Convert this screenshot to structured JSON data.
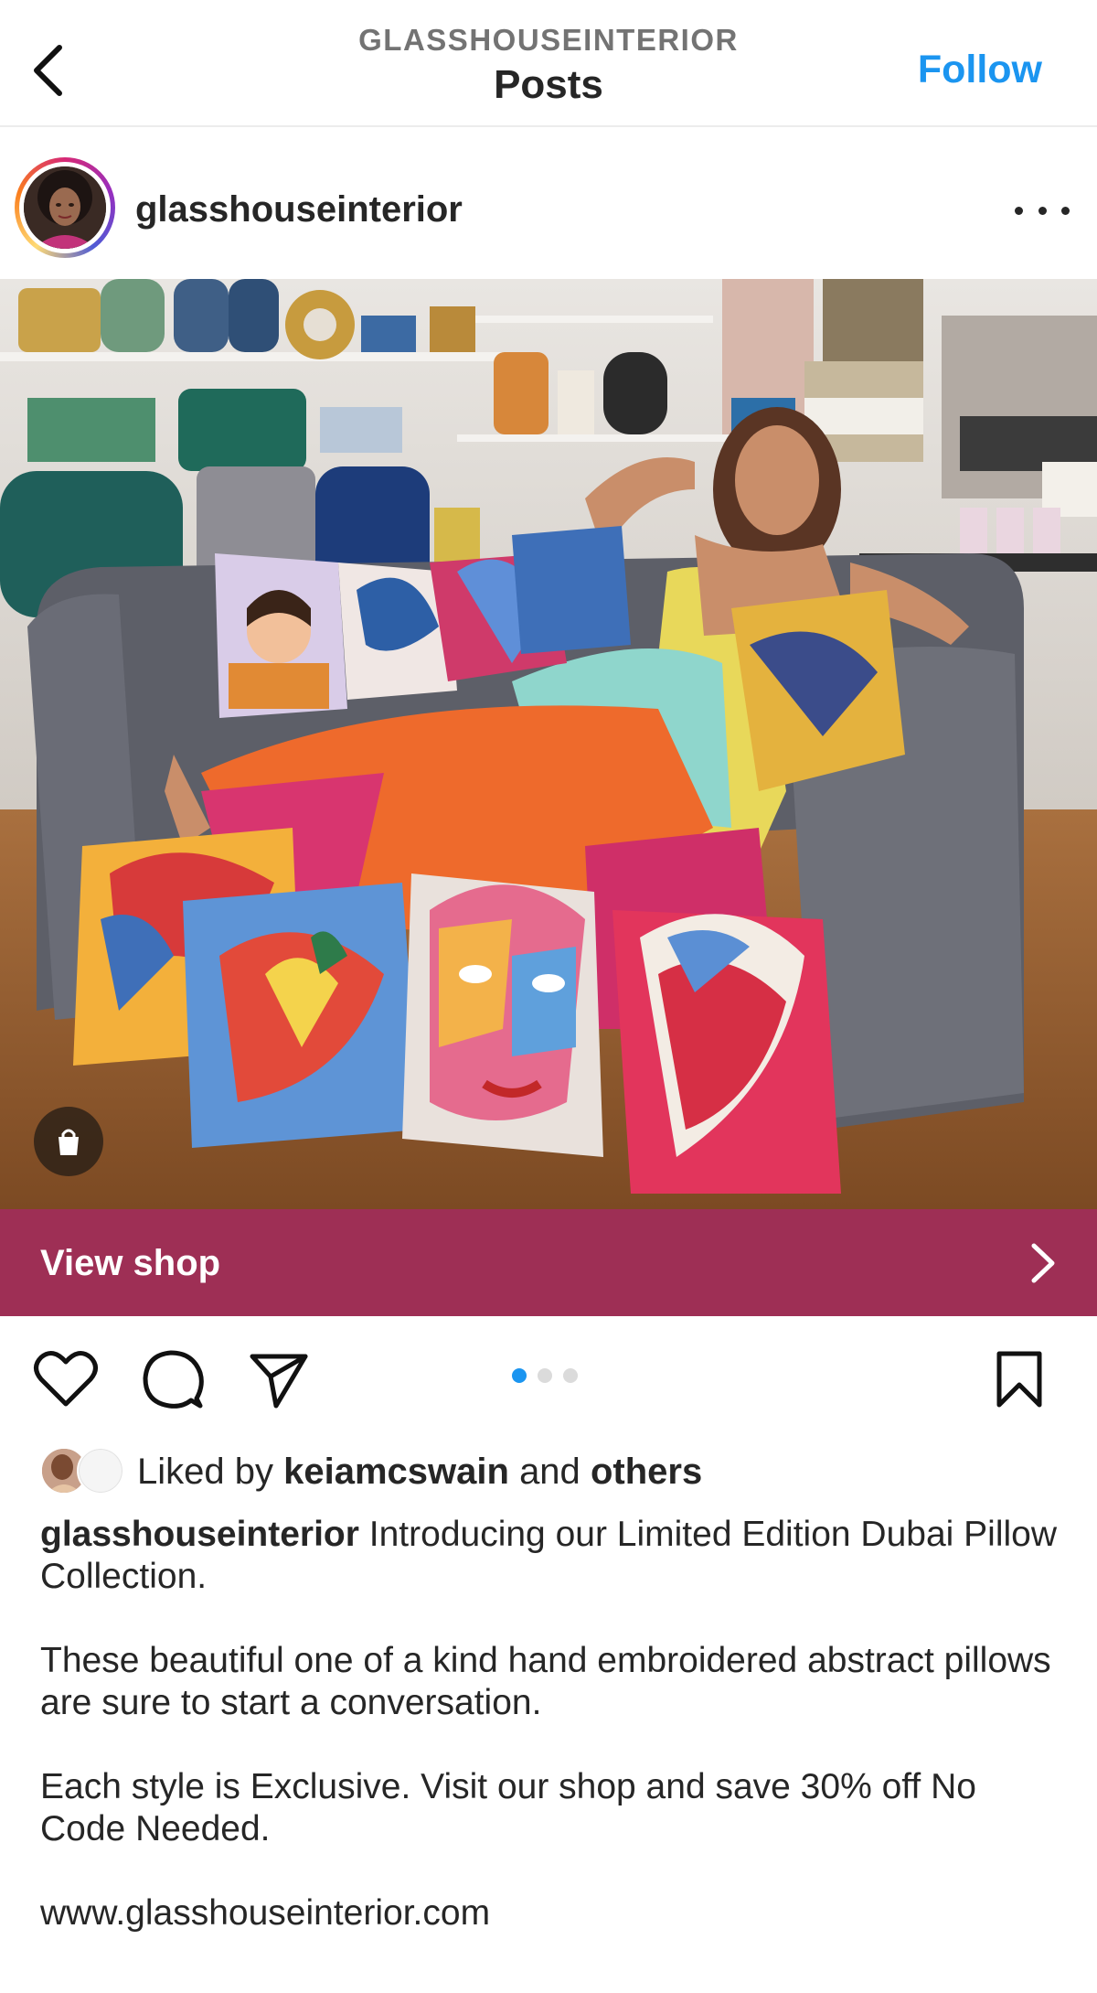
{
  "nav": {
    "account": "GLASSHOUSEINTERIOR",
    "title": "Posts",
    "follow_label": "Follow"
  },
  "post": {
    "username": "glasshouseinterior",
    "view_shop_label": "View shop",
    "carousel": {
      "count": 3,
      "active_index": 0
    },
    "likes": {
      "prefix": "Liked by",
      "user": "keiamcswain",
      "middle": "and",
      "suffix": "others"
    },
    "caption": {
      "username": "glasshouseinterior",
      "line1": "Introducing our Limited Edition Dubai Pillow Collection.",
      "para2": "These beautiful one of a kind hand embroidered abstract pillows are sure to start a conversation.",
      "para3": "Each style is Exclusive. Visit our shop and save 30% off No Code Needed.",
      "link": "www.glasshouseinterior.com"
    }
  },
  "icons": {
    "back": "chevron-left-icon",
    "more": "more-horizontal-icon",
    "like": "heart-icon",
    "comment": "comment-icon",
    "share": "paper-plane-icon",
    "save": "bookmark-icon",
    "shop_tag": "shopping-bag-icon",
    "view_shop": "chevron-right-icon"
  },
  "colors": {
    "accent": "#1b95f0",
    "shop_bar": "#9e2f55",
    "text": "#262626",
    "muted": "#737373"
  }
}
